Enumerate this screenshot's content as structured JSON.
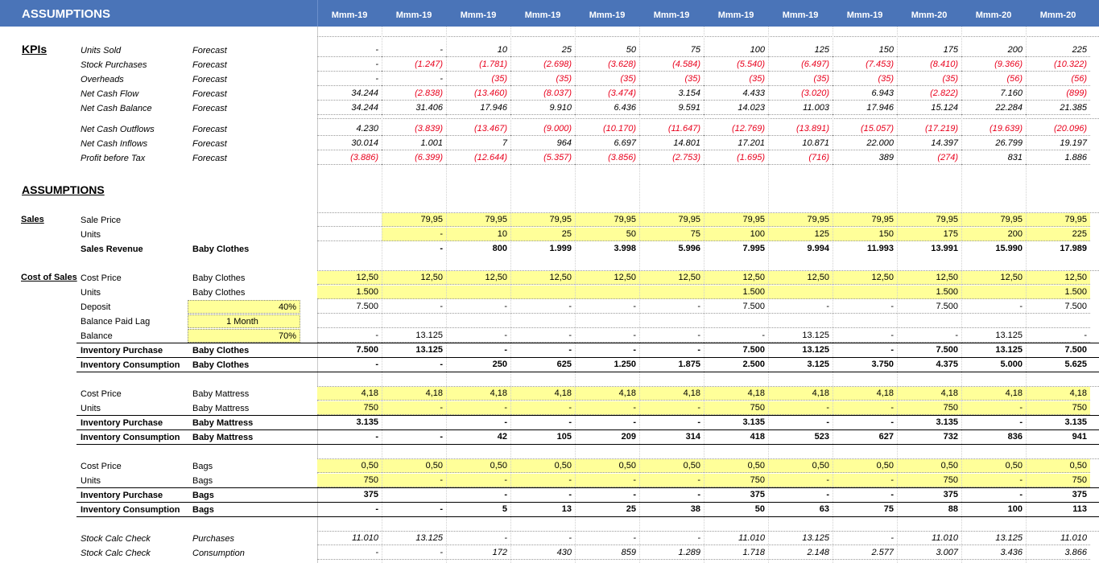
{
  "header": {
    "title": "ASSUMPTIONS",
    "months": [
      "Mmm-19",
      "Mmm-19",
      "Mmm-19",
      "Mmm-19",
      "Mmm-19",
      "Mmm-19",
      "Mmm-19",
      "Mmm-19",
      "Mmm-19",
      "Mmm-20",
      "Mmm-20",
      "Mmm-20"
    ]
  },
  "kpis": {
    "title": "KPIs",
    "rows": [
      {
        "label": "Units Sold",
        "scenario": "Forecast",
        "values": [
          "-",
          "-",
          "10",
          "25",
          "50",
          "75",
          "100",
          "125",
          "150",
          "175",
          "200",
          "225"
        ]
      },
      {
        "label": "Stock Purchases",
        "scenario": "Forecast",
        "values": [
          "-",
          "(1.247)",
          "(1.781)",
          "(2.698)",
          "(3.628)",
          "(4.584)",
          "(5.540)",
          "(6.497)",
          "(7.453)",
          "(8.410)",
          "(9.366)",
          "(10.322)"
        ]
      },
      {
        "label": "Overheads",
        "scenario": "Forecast",
        "values": [
          "-",
          "-",
          "(35)",
          "(35)",
          "(35)",
          "(35)",
          "(35)",
          "(35)",
          "(35)",
          "(35)",
          "(56)",
          "(56)"
        ]
      },
      {
        "label": "Net Cash Flow",
        "scenario": "Forecast",
        "values": [
          "34.244",
          "(2.838)",
          "(13.460)",
          "(8.037)",
          "(3.474)",
          "3.154",
          "4.433",
          "(3.020)",
          "6.943",
          "(2.822)",
          "7.160",
          "(899)"
        ]
      },
      {
        "label": "Net Cash Balance",
        "scenario": "Forecast",
        "values": [
          "34.244",
          "31.406",
          "17.946",
          "9.910",
          "6.436",
          "9.591",
          "14.023",
          "11.003",
          "17.946",
          "15.124",
          "22.284",
          "21.385"
        ]
      },
      {
        "label": "Net Cash Outflows",
        "scenario": "Forecast",
        "values": [
          "4.230",
          "(3.839)",
          "(13.467)",
          "(9.000)",
          "(10.170)",
          "(11.647)",
          "(12.769)",
          "(13.891)",
          "(15.057)",
          "(17.219)",
          "(19.639)",
          "(20.096)"
        ]
      },
      {
        "label": "Net Cash Inflows",
        "scenario": "Forecast",
        "values": [
          "30.014",
          "1.001",
          "7",
          "964",
          "6.697",
          "14.801",
          "17.201",
          "10.871",
          "22.000",
          "14.397",
          "26.799",
          "19.197"
        ]
      },
      {
        "label": "Profit before Tax",
        "scenario": "Forecast",
        "values": [
          "(3.886)",
          "(6.399)",
          "(12.644)",
          "(5.357)",
          "(3.856)",
          "(2.753)",
          "(1.695)",
          "(716)",
          "389",
          "(274)",
          "831",
          "1.886"
        ]
      }
    ]
  },
  "assumptions": {
    "title": "ASSUMPTIONS",
    "sales": {
      "group": "Sales",
      "rows": [
        {
          "label": "Sale Price",
          "sub": "",
          "values": [
            "",
            "79,95",
            "79,95",
            "79,95",
            "79,95",
            "79,95",
            "79,95",
            "79,95",
            "79,95",
            "79,95",
            "79,95",
            "79,95"
          ]
        },
        {
          "label": "Units",
          "sub": "",
          "values": [
            "",
            "-",
            "10",
            "25",
            "50",
            "75",
            "100",
            "125",
            "150",
            "175",
            "200",
            "225"
          ]
        },
        {
          "label": "Sales Revenue",
          "sub": "Baby Clothes",
          "values": [
            "",
            "-",
            "800",
            "1.999",
            "3.998",
            "5.996",
            "7.995",
            "9.994",
            "11.993",
            "13.991",
            "15.990",
            "17.989"
          ]
        }
      ]
    },
    "cos": {
      "group": "Cost of Sales",
      "clothes": [
        {
          "label": "Cost Price",
          "sub": "Baby Clothes",
          "values": [
            "12,50",
            "12,50",
            "12,50",
            "12,50",
            "12,50",
            "12,50",
            "12,50",
            "12,50",
            "12,50",
            "12,50",
            "12,50",
            "12,50"
          ]
        },
        {
          "label": "Units",
          "sub": "Baby Clothes",
          "values": [
            "1.500",
            "",
            "",
            "",
            "",
            "",
            "1.500",
            "",
            "",
            "1.500",
            "",
            "1.500"
          ]
        },
        {
          "label": "Deposit",
          "sub": "",
          "input": "40%",
          "values": [
            "7.500",
            "-",
            "-",
            "-",
            "-",
            "-",
            "7.500",
            "-",
            "-",
            "7.500",
            "-",
            "7.500"
          ]
        },
        {
          "label": "Balance Paid Lag",
          "sub": "",
          "input": "1 Month",
          "values": [
            "",
            "",
            "",
            "",
            "",
            "",
            "",
            "",
            "",
            "",
            "",
            ""
          ]
        },
        {
          "label": "Balance",
          "sub": "",
          "input": "70%",
          "values": [
            "-",
            "13.125",
            "-",
            "-",
            "-",
            "-",
            "-",
            "13.125",
            "-",
            "-",
            "13.125",
            "-"
          ]
        },
        {
          "label": "Inventory Purchase",
          "sub": "Baby Clothes",
          "values": [
            "7.500",
            "13.125",
            "-",
            "-",
            "-",
            "-",
            "7.500",
            "13.125",
            "-",
            "7.500",
            "13.125",
            "7.500"
          ]
        },
        {
          "label": "Inventory Consumption",
          "sub": "Baby Clothes",
          "values": [
            "-",
            "-",
            "250",
            "625",
            "1.250",
            "1.875",
            "2.500",
            "3.125",
            "3.750",
            "4.375",
            "5.000",
            "5.625"
          ]
        }
      ],
      "mattress": [
        {
          "label": "Cost Price",
          "sub": "Baby Mattress",
          "values": [
            "4,18",
            "4,18",
            "4,18",
            "4,18",
            "4,18",
            "4,18",
            "4,18",
            "4,18",
            "4,18",
            "4,18",
            "4,18",
            "4,18"
          ]
        },
        {
          "label": "Units",
          "sub": "Baby Mattress",
          "values": [
            "750",
            "-",
            "-",
            "-",
            "-",
            "-",
            "750",
            "-",
            "-",
            "750",
            "-",
            "750"
          ]
        },
        {
          "label": "Inventory Purchase",
          "sub": "Baby Mattress",
          "values": [
            "3.135",
            "",
            "-",
            "-",
            "-",
            "-",
            "3.135",
            "-",
            "-",
            "3.135",
            "-",
            "3.135"
          ]
        },
        {
          "label": "Inventory Consumption",
          "sub": "Baby Mattress",
          "values": [
            "-",
            "-",
            "42",
            "105",
            "209",
            "314",
            "418",
            "523",
            "627",
            "732",
            "836",
            "941"
          ]
        }
      ],
      "bags": [
        {
          "label": "Cost Price",
          "sub": "Bags",
          "values": [
            "0,50",
            "0,50",
            "0,50",
            "0,50",
            "0,50",
            "0,50",
            "0,50",
            "0,50",
            "0,50",
            "0,50",
            "0,50",
            "0,50"
          ]
        },
        {
          "label": "Units",
          "sub": "Bags",
          "values": [
            "750",
            "-",
            "-",
            "-",
            "-",
            "-",
            "750",
            "-",
            "-",
            "750",
            "-",
            "750"
          ]
        },
        {
          "label": "Inventory Purchase",
          "sub": "Bags",
          "values": [
            "375",
            "",
            "-",
            "-",
            "-",
            "-",
            "375",
            "-",
            "-",
            "375",
            "-",
            "375"
          ]
        },
        {
          "label": "Inventory Consumption",
          "sub": "Bags",
          "values": [
            "-",
            "-",
            "5",
            "13",
            "25",
            "38",
            "50",
            "63",
            "75",
            "88",
            "100",
            "113"
          ]
        }
      ],
      "checks": [
        {
          "label": "Stock Calc Check",
          "sub": "Purchases",
          "values": [
            "11.010",
            "13.125",
            "-",
            "-",
            "-",
            "-",
            "11.010",
            "13.125",
            "-",
            "11.010",
            "13.125",
            "11.010"
          ]
        },
        {
          "label": "Stock Calc Check",
          "sub": "Consumption",
          "values": [
            "-",
            "-",
            "172",
            "430",
            "859",
            "1.289",
            "1.718",
            "2.148",
            "2.577",
            "3.007",
            "3.436",
            "3.866"
          ]
        }
      ]
    }
  },
  "colors": {
    "header_bg": "#4a74b8",
    "input_bg": "#ffff99",
    "negative": "#e8001c"
  }
}
